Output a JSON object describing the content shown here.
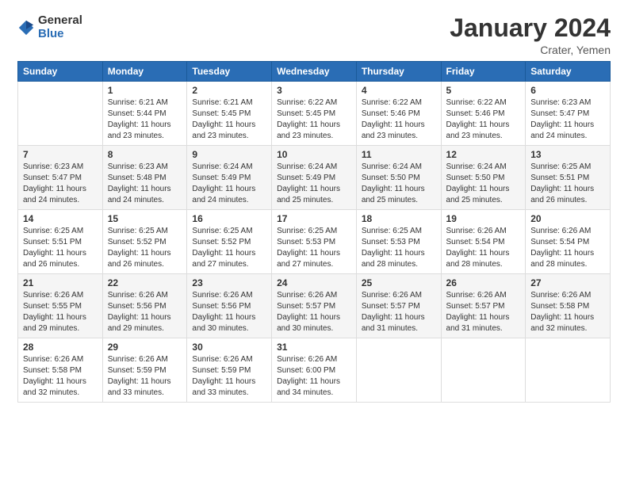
{
  "logo": {
    "general": "General",
    "blue": "Blue"
  },
  "title": "January 2024",
  "subtitle": "Crater, Yemen",
  "headers": [
    "Sunday",
    "Monday",
    "Tuesday",
    "Wednesday",
    "Thursday",
    "Friday",
    "Saturday"
  ],
  "weeks": [
    [
      {
        "day": "",
        "info": ""
      },
      {
        "day": "1",
        "info": "Sunrise: 6:21 AM\nSunset: 5:44 PM\nDaylight: 11 hours\nand 23 minutes."
      },
      {
        "day": "2",
        "info": "Sunrise: 6:21 AM\nSunset: 5:45 PM\nDaylight: 11 hours\nand 23 minutes."
      },
      {
        "day": "3",
        "info": "Sunrise: 6:22 AM\nSunset: 5:45 PM\nDaylight: 11 hours\nand 23 minutes."
      },
      {
        "day": "4",
        "info": "Sunrise: 6:22 AM\nSunset: 5:46 PM\nDaylight: 11 hours\nand 23 minutes."
      },
      {
        "day": "5",
        "info": "Sunrise: 6:22 AM\nSunset: 5:46 PM\nDaylight: 11 hours\nand 23 minutes."
      },
      {
        "day": "6",
        "info": "Sunrise: 6:23 AM\nSunset: 5:47 PM\nDaylight: 11 hours\nand 24 minutes."
      }
    ],
    [
      {
        "day": "7",
        "info": "Sunrise: 6:23 AM\nSunset: 5:47 PM\nDaylight: 11 hours\nand 24 minutes."
      },
      {
        "day": "8",
        "info": "Sunrise: 6:23 AM\nSunset: 5:48 PM\nDaylight: 11 hours\nand 24 minutes."
      },
      {
        "day": "9",
        "info": "Sunrise: 6:24 AM\nSunset: 5:49 PM\nDaylight: 11 hours\nand 24 minutes."
      },
      {
        "day": "10",
        "info": "Sunrise: 6:24 AM\nSunset: 5:49 PM\nDaylight: 11 hours\nand 25 minutes."
      },
      {
        "day": "11",
        "info": "Sunrise: 6:24 AM\nSunset: 5:50 PM\nDaylight: 11 hours\nand 25 minutes."
      },
      {
        "day": "12",
        "info": "Sunrise: 6:24 AM\nSunset: 5:50 PM\nDaylight: 11 hours\nand 25 minutes."
      },
      {
        "day": "13",
        "info": "Sunrise: 6:25 AM\nSunset: 5:51 PM\nDaylight: 11 hours\nand 26 minutes."
      }
    ],
    [
      {
        "day": "14",
        "info": "Sunrise: 6:25 AM\nSunset: 5:51 PM\nDaylight: 11 hours\nand 26 minutes."
      },
      {
        "day": "15",
        "info": "Sunrise: 6:25 AM\nSunset: 5:52 PM\nDaylight: 11 hours\nand 26 minutes."
      },
      {
        "day": "16",
        "info": "Sunrise: 6:25 AM\nSunset: 5:52 PM\nDaylight: 11 hours\nand 27 minutes."
      },
      {
        "day": "17",
        "info": "Sunrise: 6:25 AM\nSunset: 5:53 PM\nDaylight: 11 hours\nand 27 minutes."
      },
      {
        "day": "18",
        "info": "Sunrise: 6:25 AM\nSunset: 5:53 PM\nDaylight: 11 hours\nand 28 minutes."
      },
      {
        "day": "19",
        "info": "Sunrise: 6:26 AM\nSunset: 5:54 PM\nDaylight: 11 hours\nand 28 minutes."
      },
      {
        "day": "20",
        "info": "Sunrise: 6:26 AM\nSunset: 5:54 PM\nDaylight: 11 hours\nand 28 minutes."
      }
    ],
    [
      {
        "day": "21",
        "info": "Sunrise: 6:26 AM\nSunset: 5:55 PM\nDaylight: 11 hours\nand 29 minutes."
      },
      {
        "day": "22",
        "info": "Sunrise: 6:26 AM\nSunset: 5:56 PM\nDaylight: 11 hours\nand 29 minutes."
      },
      {
        "day": "23",
        "info": "Sunrise: 6:26 AM\nSunset: 5:56 PM\nDaylight: 11 hours\nand 30 minutes."
      },
      {
        "day": "24",
        "info": "Sunrise: 6:26 AM\nSunset: 5:57 PM\nDaylight: 11 hours\nand 30 minutes."
      },
      {
        "day": "25",
        "info": "Sunrise: 6:26 AM\nSunset: 5:57 PM\nDaylight: 11 hours\nand 31 minutes."
      },
      {
        "day": "26",
        "info": "Sunrise: 6:26 AM\nSunset: 5:57 PM\nDaylight: 11 hours\nand 31 minutes."
      },
      {
        "day": "27",
        "info": "Sunrise: 6:26 AM\nSunset: 5:58 PM\nDaylight: 11 hours\nand 32 minutes."
      }
    ],
    [
      {
        "day": "28",
        "info": "Sunrise: 6:26 AM\nSunset: 5:58 PM\nDaylight: 11 hours\nand 32 minutes."
      },
      {
        "day": "29",
        "info": "Sunrise: 6:26 AM\nSunset: 5:59 PM\nDaylight: 11 hours\nand 33 minutes."
      },
      {
        "day": "30",
        "info": "Sunrise: 6:26 AM\nSunset: 5:59 PM\nDaylight: 11 hours\nand 33 minutes."
      },
      {
        "day": "31",
        "info": "Sunrise: 6:26 AM\nSunset: 6:00 PM\nDaylight: 11 hours\nand 34 minutes."
      },
      {
        "day": "",
        "info": ""
      },
      {
        "day": "",
        "info": ""
      },
      {
        "day": "",
        "info": ""
      }
    ]
  ]
}
